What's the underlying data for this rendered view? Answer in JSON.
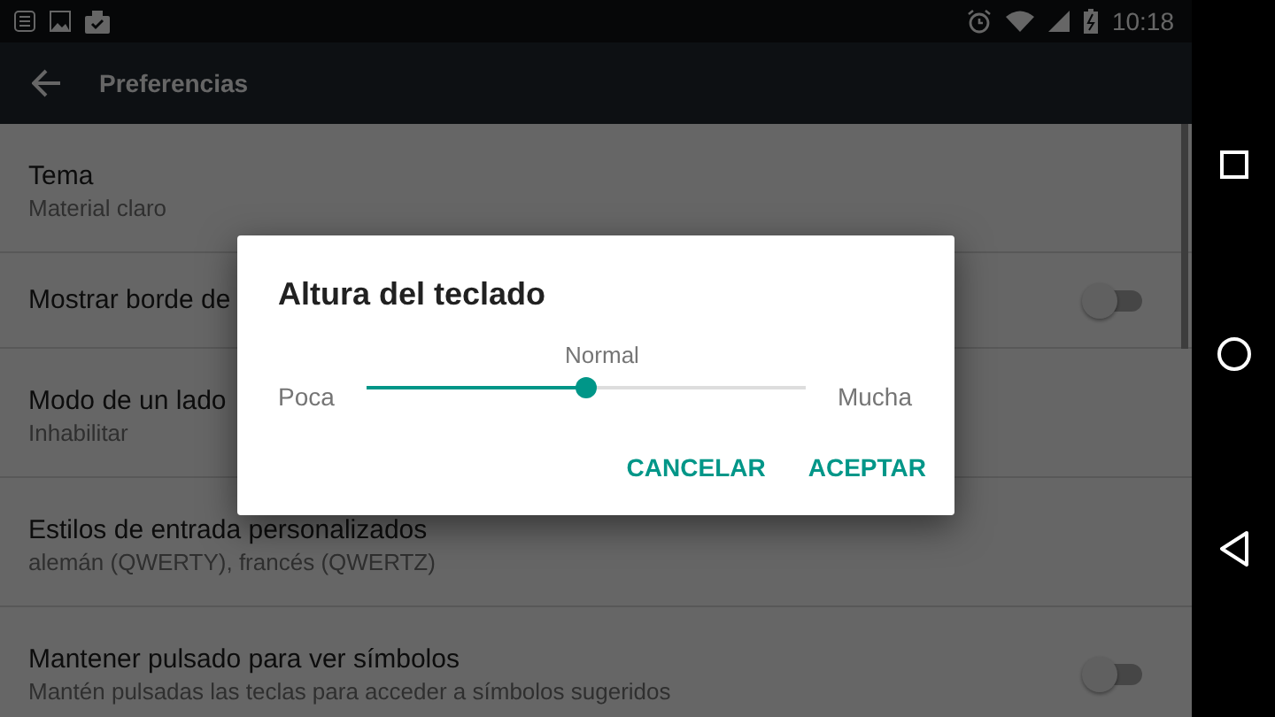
{
  "status_bar": {
    "time": "10:18"
  },
  "app_bar": {
    "title": "Preferencias"
  },
  "settings": [
    {
      "kind": "text",
      "title": "Tema",
      "summary": "Material claro"
    },
    {
      "kind": "switch",
      "title": "Mostrar borde de",
      "on": false
    },
    {
      "kind": "text",
      "title": "Modo de un lado",
      "summary": "Inhabilitar"
    },
    {
      "kind": "text",
      "title": "Estilos de entrada personalizados",
      "summary": "alemán (QWERTY), francés (QWERTZ)"
    },
    {
      "kind": "switch",
      "title": "Mantener pulsado para ver símbolos",
      "summary": "Mantén pulsadas las teclas para acceder a símbolos sugeridos",
      "on": false
    }
  ],
  "dialog": {
    "title": "Altura del teclado",
    "value_label": "Normal",
    "min_label": "Poca",
    "max_label": "Mucha",
    "level": 0.5,
    "buttons": [
      "CANCELAR",
      "ACEPTAR"
    ]
  }
}
